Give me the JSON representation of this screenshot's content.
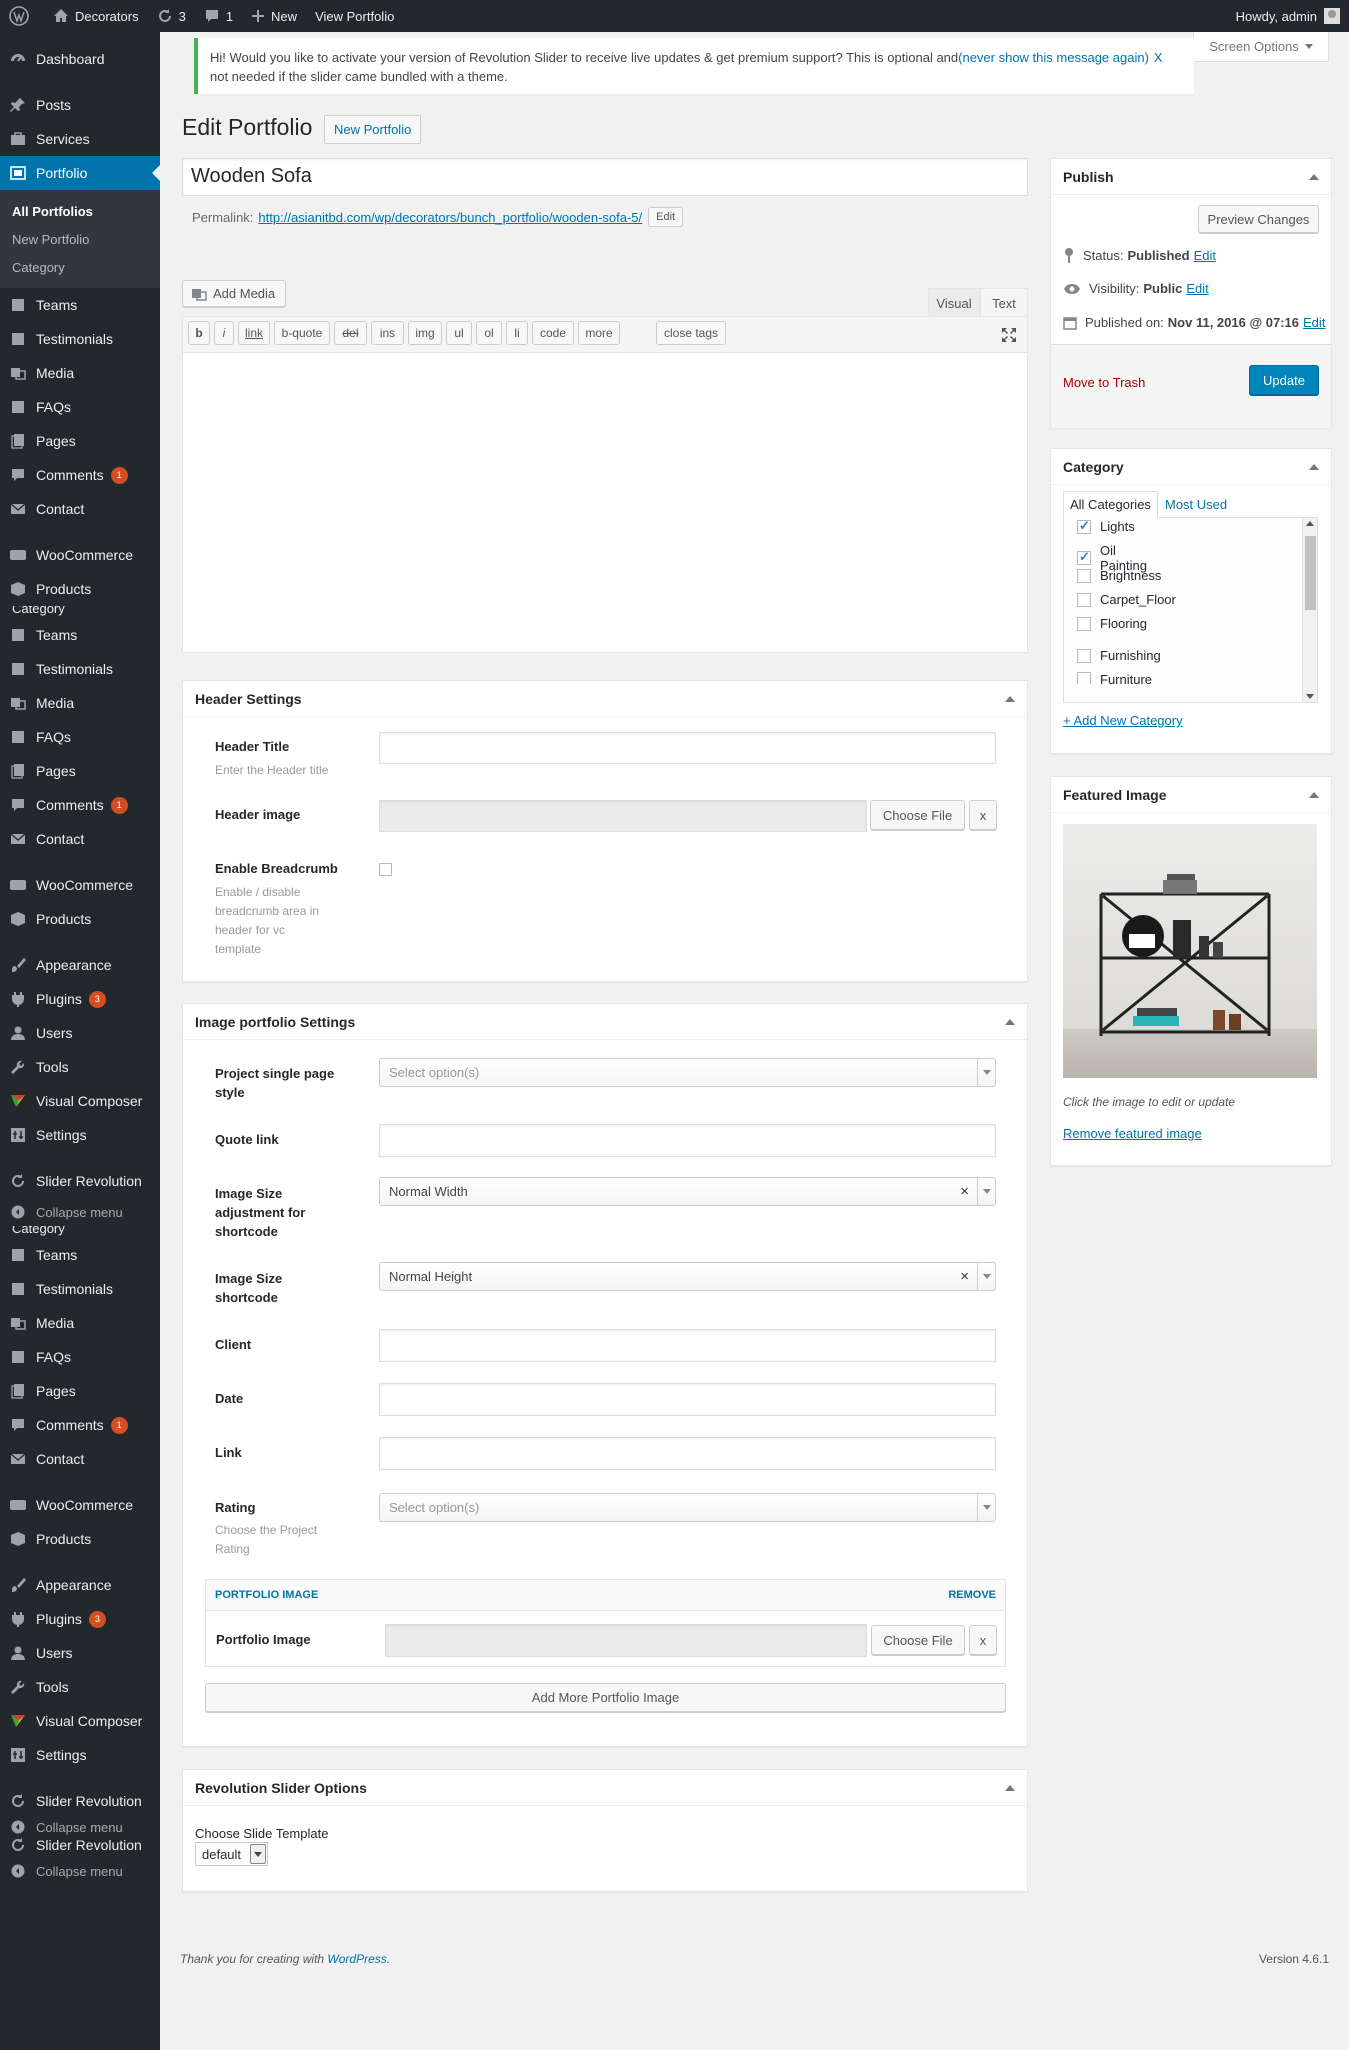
{
  "adminbar": {
    "site": "Decorators",
    "updates": "3",
    "comments": "1",
    "new": "New",
    "view": "View Portfolio",
    "howdy": "Howdy, admin"
  },
  "sidebar": {
    "dashboard": "Dashboard",
    "posts": "Posts",
    "services": "Services",
    "portfolio": "Portfolio",
    "portfolio_sub": [
      "All Portfolios",
      "New Portfolio",
      "Category"
    ],
    "teams": "Teams",
    "testimonials": "Testimonials",
    "media": "Media",
    "faqs": "FAQs",
    "pages": "Pages",
    "comments": "Comments",
    "comments_badge": "1",
    "contact": "Contact",
    "woocommerce": "WooCommerce",
    "products": "Products",
    "category": "Category",
    "appearance": "Appearance",
    "plugins": "Plugins",
    "plugins_badge": "3",
    "users": "Users",
    "tools": "Tools",
    "visual_composer": "Visual Composer",
    "settings": "Settings",
    "slider_revolution": "Slider Revolution",
    "collapse": "Collapse menu"
  },
  "notice": {
    "text": "Hi! Would you like to activate your version of Revolution Slider to receive live updates & get premium support? This is optional and",
    "link": "(never show this message again)",
    "x": "X",
    "text2": "not needed if the slider came bundled with a theme."
  },
  "screen_options": "Screen Options",
  "page": {
    "title": "Edit Portfolio",
    "new_button": "New Portfolio",
    "post_title": "Wooden Sofa",
    "permalink_label": "Permalink:",
    "permalink_url": "http://asianitbd.com/wp/decorators/bunch_portfolio/wooden-sofa-5/",
    "permalink_edit": "Edit",
    "add_media": "Add Media",
    "tab_visual": "Visual",
    "tab_text": "Text",
    "quicktags": [
      "b",
      "i",
      "link",
      "b-quote",
      "del",
      "ins",
      "img",
      "ul",
      "ol",
      "li",
      "code",
      "more",
      "close tags"
    ]
  },
  "header_settings": {
    "title": "Header Settings",
    "header_title_label": "Header Title",
    "header_title_desc": "Enter the Header title",
    "header_image_label": "Header image",
    "choose_file": "Choose File",
    "x": "x",
    "breadcrumb_label": "Enable Breadcrumb",
    "breadcrumb_desc": [
      "Enable / disable",
      "breadcrumb area in",
      "header for vc",
      "template"
    ]
  },
  "image_portfolio": {
    "title": "Image portfolio Settings",
    "style_label": [
      "Project single page",
      "style"
    ],
    "style_placeholder": "Select option(s)",
    "quote_label": "Quote link",
    "size_adj_label": [
      "Image Size",
      "adjustment for",
      "shortcode"
    ],
    "size_adj_value": "Normal Width",
    "size_label": [
      "Image Size",
      "shortcode"
    ],
    "size_value": "Normal Height",
    "client_label": "Client",
    "date_label": "Date",
    "link_label": "Link",
    "rating_label": "Rating",
    "rating_desc": [
      "Choose the Project",
      "Rating"
    ],
    "rating_placeholder": "Select option(s)",
    "portfolio_image_header": "PORTFOLIO IMAGE",
    "remove": "REMOVE",
    "portfolio_image_label": "Portfolio Image",
    "choose_file": "Choose File",
    "x": "x",
    "add_more": "Add More Portfolio Image"
  },
  "rev_slider": {
    "title": "Revolution Slider Options",
    "template_label": "Choose Slide Template",
    "template_value": "default"
  },
  "publish": {
    "title": "Publish",
    "preview": "Preview Changes",
    "status_label": "Status:",
    "status_value": "Published",
    "visibility_label": "Visibility:",
    "visibility_value": "Public",
    "published_label": "Published on:",
    "published_value": "Nov 11, 2016 @ 07:16",
    "edit": "Edit",
    "trash": "Move to Trash",
    "update": "Update"
  },
  "category_box": {
    "title": "Category",
    "tab_all": "All Categories",
    "tab_used": "Most Used",
    "items": [
      {
        "label": "Lights",
        "checked": true
      },
      {
        "label": "Oil Painting",
        "checked": true
      },
      {
        "label": "Brightness",
        "checked": false
      },
      {
        "label": "Carpet_Floor",
        "checked": false
      },
      {
        "label": "Flooring",
        "checked": false
      },
      {
        "label": "Furnishing",
        "checked": false
      },
      {
        "label": "Furniture",
        "checked": false
      }
    ],
    "add_new": "+ Add New Category"
  },
  "featured_image": {
    "title": "Featured Image",
    "hint": "Click the image to edit or update",
    "remove": "Remove featured image"
  },
  "footer": {
    "thanks": "Thank you for creating with",
    "wordpress": "WordPress.",
    "version": "Version 4.6.1"
  },
  "colors": {
    "accent": "#0073aa",
    "sidebar_bg": "#23282d",
    "badge": "#d54e21",
    "notice_border": "#46b450",
    "trash": "#a00"
  }
}
